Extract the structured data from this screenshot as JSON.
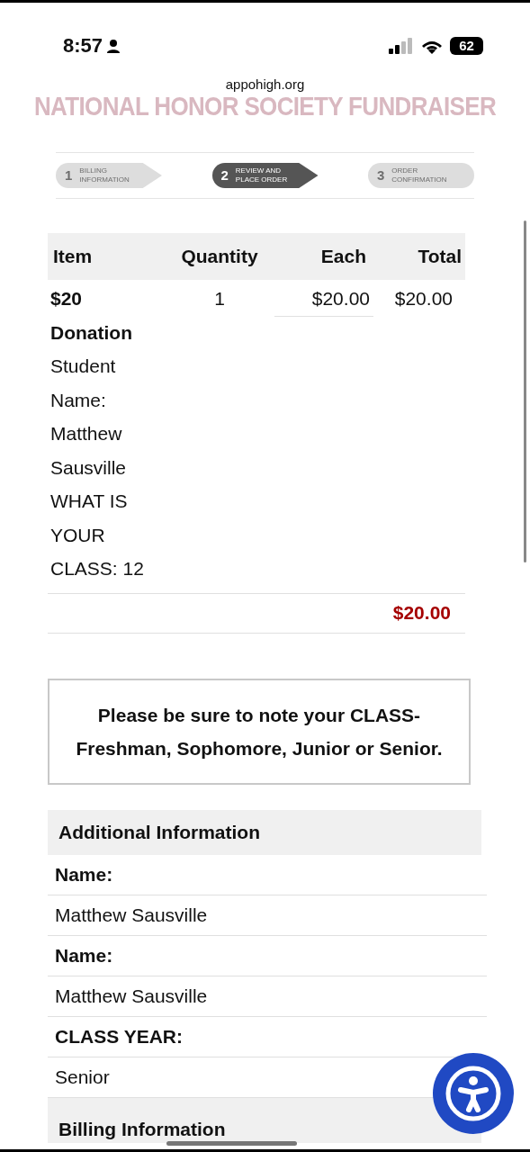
{
  "status_bar": {
    "time": "8:57",
    "battery": "62"
  },
  "url": "appohigh.org",
  "page_title": "NATIONAL HONOR SOCIETY FUNDRAISER",
  "steps": [
    {
      "number": "1",
      "label": "BILLING\nINFORMATION",
      "selected": false
    },
    {
      "number": "2",
      "label": "REVIEW AND\nPLACE ORDER",
      "selected": true
    },
    {
      "number": "3",
      "label": "ORDER\nCONFIRMATION",
      "selected": false
    }
  ],
  "order_table": {
    "columns": [
      "Item",
      "Quantity",
      "Each",
      "Total"
    ],
    "rows": [
      {
        "item": "$20 Donation",
        "details": "Student Name: Matthew Sausville WHAT IS YOUR CLASS: 12",
        "quantity": "1",
        "each": "$20.00",
        "total": "$20.00"
      }
    ],
    "grand_total": "$20.00"
  },
  "notice": "Please be sure to note your CLASS- Freshman, Sophomore, Junior or Senior.",
  "additional_information": {
    "heading": "Additional Information",
    "fields": [
      {
        "label": "Name:",
        "value": "Matthew Sausville"
      },
      {
        "label": "Name:",
        "value": "Matthew Sausville"
      },
      {
        "label": "CLASS YEAR:",
        "value": "Senior"
      }
    ]
  },
  "next_section": {
    "heading": "Billing Information"
  }
}
